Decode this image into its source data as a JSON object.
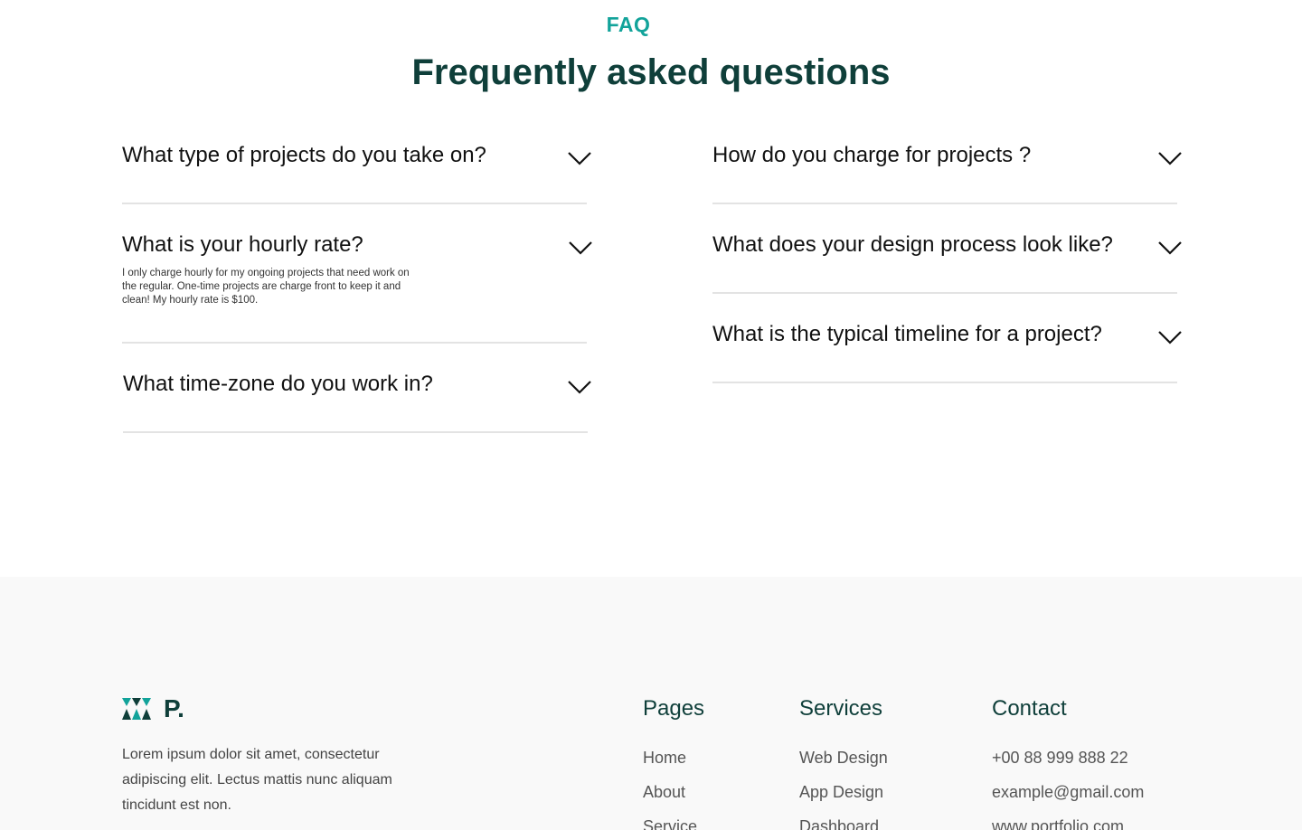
{
  "faq": {
    "eyebrow": "FAQ",
    "title": "Frequently asked questions",
    "items": [
      {
        "question": "What type of projects do you take on?",
        "answer": ""
      },
      {
        "question": "What is your hourly rate?",
        "answer": "I only charge hourly for my ongoing projects that need work on the regular. One-time projects are charge front to keep it  and clean! My hourly rate is $100."
      },
      {
        "question": "What time-zone do you work in?",
        "answer": ""
      },
      {
        "question": "How do you charge for projects ?",
        "answer": ""
      },
      {
        "question": "What does your design process look like?",
        "answer": ""
      },
      {
        "question": "What is the typical timeline for a project?",
        "answer": ""
      }
    ],
    "icon": "chevron-down-icon"
  },
  "footer": {
    "logo_text": "P.",
    "logo_icon": "triangles-logo-icon",
    "description": "Lorem ipsum dolor sit amet, consectetur adipiscing elit. Lectus mattis nunc aliquam tincidunt est non.",
    "columns": [
      {
        "heading": "Pages",
        "links": [
          "Home",
          "About",
          "Service"
        ]
      },
      {
        "heading": "Services",
        "links": [
          "Web Design",
          "App Design",
          "Dashboard"
        ]
      },
      {
        "heading": "Contact",
        "links": [
          "+00 88 999 888 22",
          "example@gmail.com",
          "www.portfolio.com"
        ]
      }
    ]
  },
  "colors": {
    "accent": "#12a39a",
    "heading": "#0f3f3a",
    "divider": "#e3e3e3",
    "footer_bg": "#f9f9f9"
  }
}
